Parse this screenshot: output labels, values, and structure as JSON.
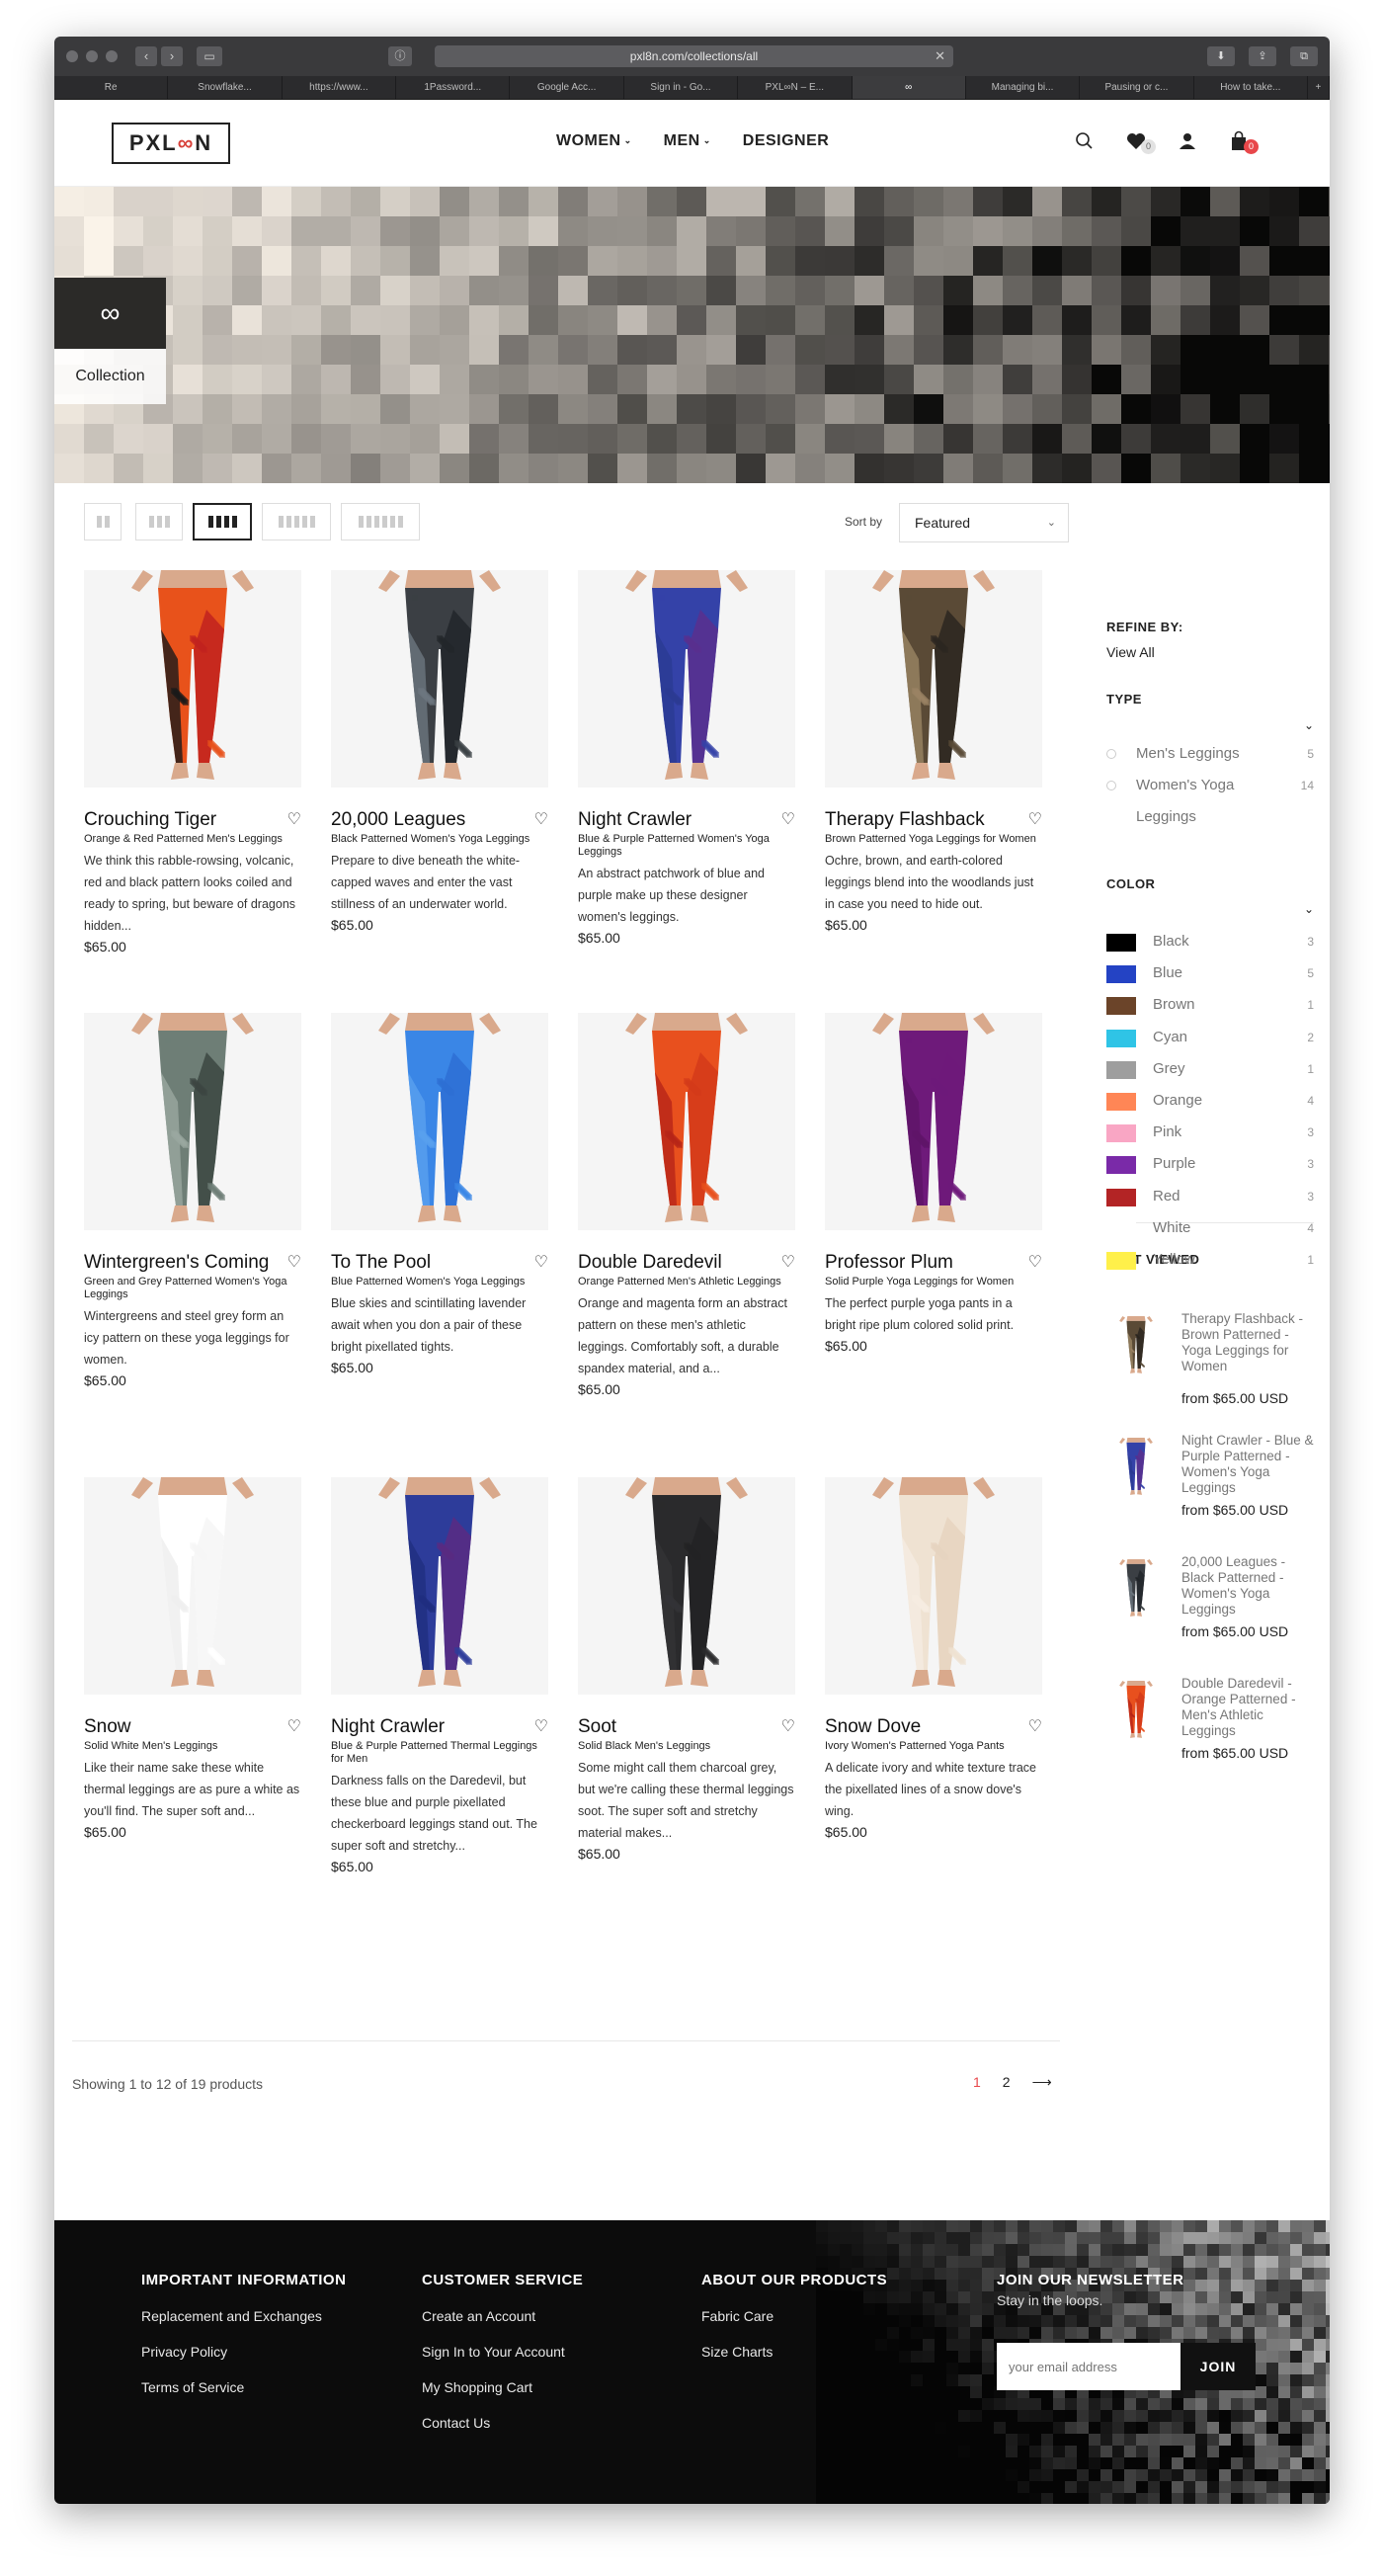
{
  "browser": {
    "url": "pxl8n.com/collections/all",
    "tabs": [
      "Re",
      "Snowflake...",
      "https://www...",
      "1Password...",
      "Google Acc...",
      "Sign in - Go...",
      "PXL∞N – E...",
      "∞",
      "Managing bi...",
      "Pausing or c...",
      "How to take..."
    ],
    "active_tab": 7
  },
  "header": {
    "logo_text": "PXLOON",
    "nav": [
      {
        "label": "WOMEN",
        "has_dropdown": true
      },
      {
        "label": "MEN",
        "has_dropdown": true
      },
      {
        "label": "DESIGNER",
        "has_dropdown": false
      }
    ],
    "wishlist_count": "0",
    "cart_count": "0"
  },
  "hero": {
    "symbol": "∞",
    "label": "Collection"
  },
  "toolbar": {
    "sort_label": "Sort by",
    "sort_value": "Featured",
    "active_grid": 2
  },
  "products": [
    {
      "title": "Crouching Tiger",
      "subtitle": "Orange & Red Patterned Men's Leggings",
      "desc": "We think this rabble-rowsing, volcanic, red and black pattern looks coiled and ready to spring, but beware of dragons hidden...",
      "price": "$65.00",
      "colors": [
        "#e8521b",
        "#c1221f",
        "#1a1a1a"
      ]
    },
    {
      "title": "20,000 Leagues",
      "subtitle": "Black Patterned Women's Yoga Leggings",
      "desc": "Prepare to dive beneath the white-capped waves and enter the vast stillness of an underwater world.",
      "price": "$65.00",
      "colors": [
        "#3b3f44",
        "#22262a",
        "#6d7780"
      ]
    },
    {
      "title": "Night Crawler",
      "subtitle": "Blue & Purple Patterned Women's Yoga Leggings",
      "desc": "An abstract patchwork of blue and purple make up these designer women's leggings.",
      "price": "$65.00",
      "colors": [
        "#3442a8",
        "#5a2f8e",
        "#2b3b92"
      ]
    },
    {
      "title": "Therapy Flashback",
      "subtitle": "Brown Patterned Yoga Leggings for Women",
      "desc": "Ochre, brown, and earth-colored leggings blend into the woodlands just in case you need to hide out.",
      "price": "$65.00",
      "colors": [
        "#5a4a36",
        "#2c2620",
        "#9a8464"
      ]
    },
    {
      "title": "Wintergreen's Coming",
      "subtitle": "Green and Grey Patterned Women's Yoga Leggings",
      "desc": "Wintergreens and steel grey form an icy pattern on these yoga leggings for women.",
      "price": "$65.00",
      "colors": [
        "#6e7e76",
        "#3c4642",
        "#9aa8a0"
      ]
    },
    {
      "title": "To The Pool",
      "subtitle": "Blue Patterned Women's Yoga Leggings",
      "desc": "Blue skies and scintillating lavender await when you don a pair of these bright pixellated tights.",
      "price": "$65.00",
      "colors": [
        "#3a86e6",
        "#2e6fd4",
        "#5aa0ef"
      ]
    },
    {
      "title": "Double Daredevil",
      "subtitle": "Orange Patterned Men's Athletic Leggings",
      "desc": "Orange and magenta form an abstract pattern on these men's athletic leggings. Comfortably soft, a durable spandex material, and a...",
      "price": "$65.00",
      "colors": [
        "#e8501e",
        "#d43a1a",
        "#b62418"
      ]
    },
    {
      "title": "Professor Plum",
      "subtitle": "Solid Purple Yoga Leggings for Women",
      "desc": "The perfect purple yoga pants in a bright ripe plum colored solid print.",
      "price": "$65.00",
      "colors": [
        "#6e1a7a",
        "#6e1a7a",
        "#5e1468"
      ]
    },
    {
      "title": "Snow",
      "subtitle": "Solid White Men's Leggings",
      "desc": "Like their name sake these white thermal leggings are as pure a white as you'll find. The super soft and...",
      "price": "$65.00",
      "colors": [
        "#ffffff",
        "#f6f6f6",
        "#eeeeee"
      ]
    },
    {
      "title": "Night Crawler",
      "subtitle": "Blue & Purple Patterned Thermal Leggings for Men",
      "desc": "Darkness falls on the Daredevil, but these blue and purple pixellated checkerboard leggings stand out. The super soft and stretchy...",
      "price": "$65.00",
      "colors": [
        "#2d3c9a",
        "#5a2a82",
        "#1f2e80"
      ]
    },
    {
      "title": "Soot",
      "subtitle": "Solid Black Men's Leggings",
      "desc": "Some might call them charcoal grey, but we're calling these thermal leggings soot. The super soft and stretchy material makes...",
      "price": "$65.00",
      "colors": [
        "#2a2a2c",
        "#222224",
        "#333336"
      ]
    },
    {
      "title": "Snow Dove",
      "subtitle": "Ivory Women's Patterned Yoga Pants",
      "desc": "A delicate ivory and white texture trace the pixellated lines of a snow dove's wing.",
      "price": "$65.00",
      "colors": [
        "#efe2d2",
        "#e6d4c0",
        "#f5ece2"
      ]
    }
  ],
  "pagination": {
    "showing": "Showing 1 to 12 of 19 products",
    "pages": [
      "1",
      "2"
    ],
    "current": "1"
  },
  "sidebar": {
    "refine_by": "REFINE BY:",
    "view_all": "View All",
    "type_heading": "TYPE",
    "types": [
      {
        "label": "Men's Leggings",
        "count": "5"
      },
      {
        "label": "Women's Yoga Leggings",
        "count": "14"
      }
    ],
    "color_heading": "COLOR",
    "colors": [
      {
        "label": "Black",
        "count": "3",
        "swatch": "#000000"
      },
      {
        "label": "Blue",
        "count": "5",
        "swatch": "#2443c4"
      },
      {
        "label": "Brown",
        "count": "1",
        "swatch": "#6b4429"
      },
      {
        "label": "Cyan",
        "count": "2",
        "swatch": "#2fc4e6"
      },
      {
        "label": "Grey",
        "count": "1",
        "swatch": "#9e9e9e"
      },
      {
        "label": "Orange",
        "count": "4",
        "swatch": "#ff8656"
      },
      {
        "label": "Pink",
        "count": "3",
        "swatch": "#f9a6c4"
      },
      {
        "label": "Purple",
        "count": "3",
        "swatch": "#7a2aa8"
      },
      {
        "label": "Red",
        "count": "3",
        "swatch": "#b32425"
      },
      {
        "label": "White",
        "count": "4",
        "swatch": "#ffffff"
      },
      {
        "label": "Yellow",
        "count": "1",
        "swatch": "#fff04a"
      }
    ],
    "last_viewed_heading": "LAST VIEWED",
    "last_viewed": [
      {
        "name": "Therapy Flashback - Brown Patterned - Yoga Leggings for Women",
        "price": "from $65.00 USD",
        "colors": [
          "#5a4a36",
          "#2c2620",
          "#9a8464"
        ]
      },
      {
        "name": "Night Crawler - Blue & Purple Patterned - Women's Yoga Leggings",
        "price": "from $65.00 USD",
        "colors": [
          "#3442a8",
          "#5a2f8e",
          "#2b3b92"
        ]
      },
      {
        "name": "20,000 Leagues - Black Patterned - Women's Yoga Leggings",
        "price": "from $65.00 USD",
        "colors": [
          "#3b3f44",
          "#22262a",
          "#6d7780"
        ]
      },
      {
        "name": "Double Daredevil - Orange Patterned - Men's Athletic Leggings",
        "price": "from $65.00 USD",
        "colors": [
          "#e8501e",
          "#d43a1a",
          "#b62418"
        ]
      }
    ]
  },
  "footer": {
    "columns": [
      {
        "heading": "IMPORTANT INFORMATION",
        "links": [
          "Replacement and Exchanges",
          "Privacy Policy",
          "Terms of Service"
        ]
      },
      {
        "heading": "CUSTOMER SERVICE",
        "links": [
          "Create an Account",
          "Sign In to Your Account",
          "My Shopping Cart",
          "Contact Us"
        ]
      },
      {
        "heading": "ABOUT OUR PRODUCTS",
        "links": [
          "Fabric Care",
          "Size Charts"
        ]
      }
    ],
    "newsletter": {
      "heading": "JOIN OUR NEWSLETTER",
      "subtitle": "Stay in the loops.",
      "placeholder": "your email address",
      "button": "JOIN"
    }
  },
  "icons": {
    "search": "search-icon",
    "wishlist": "heart-icon",
    "account": "user-icon",
    "cart": "bag-icon"
  }
}
